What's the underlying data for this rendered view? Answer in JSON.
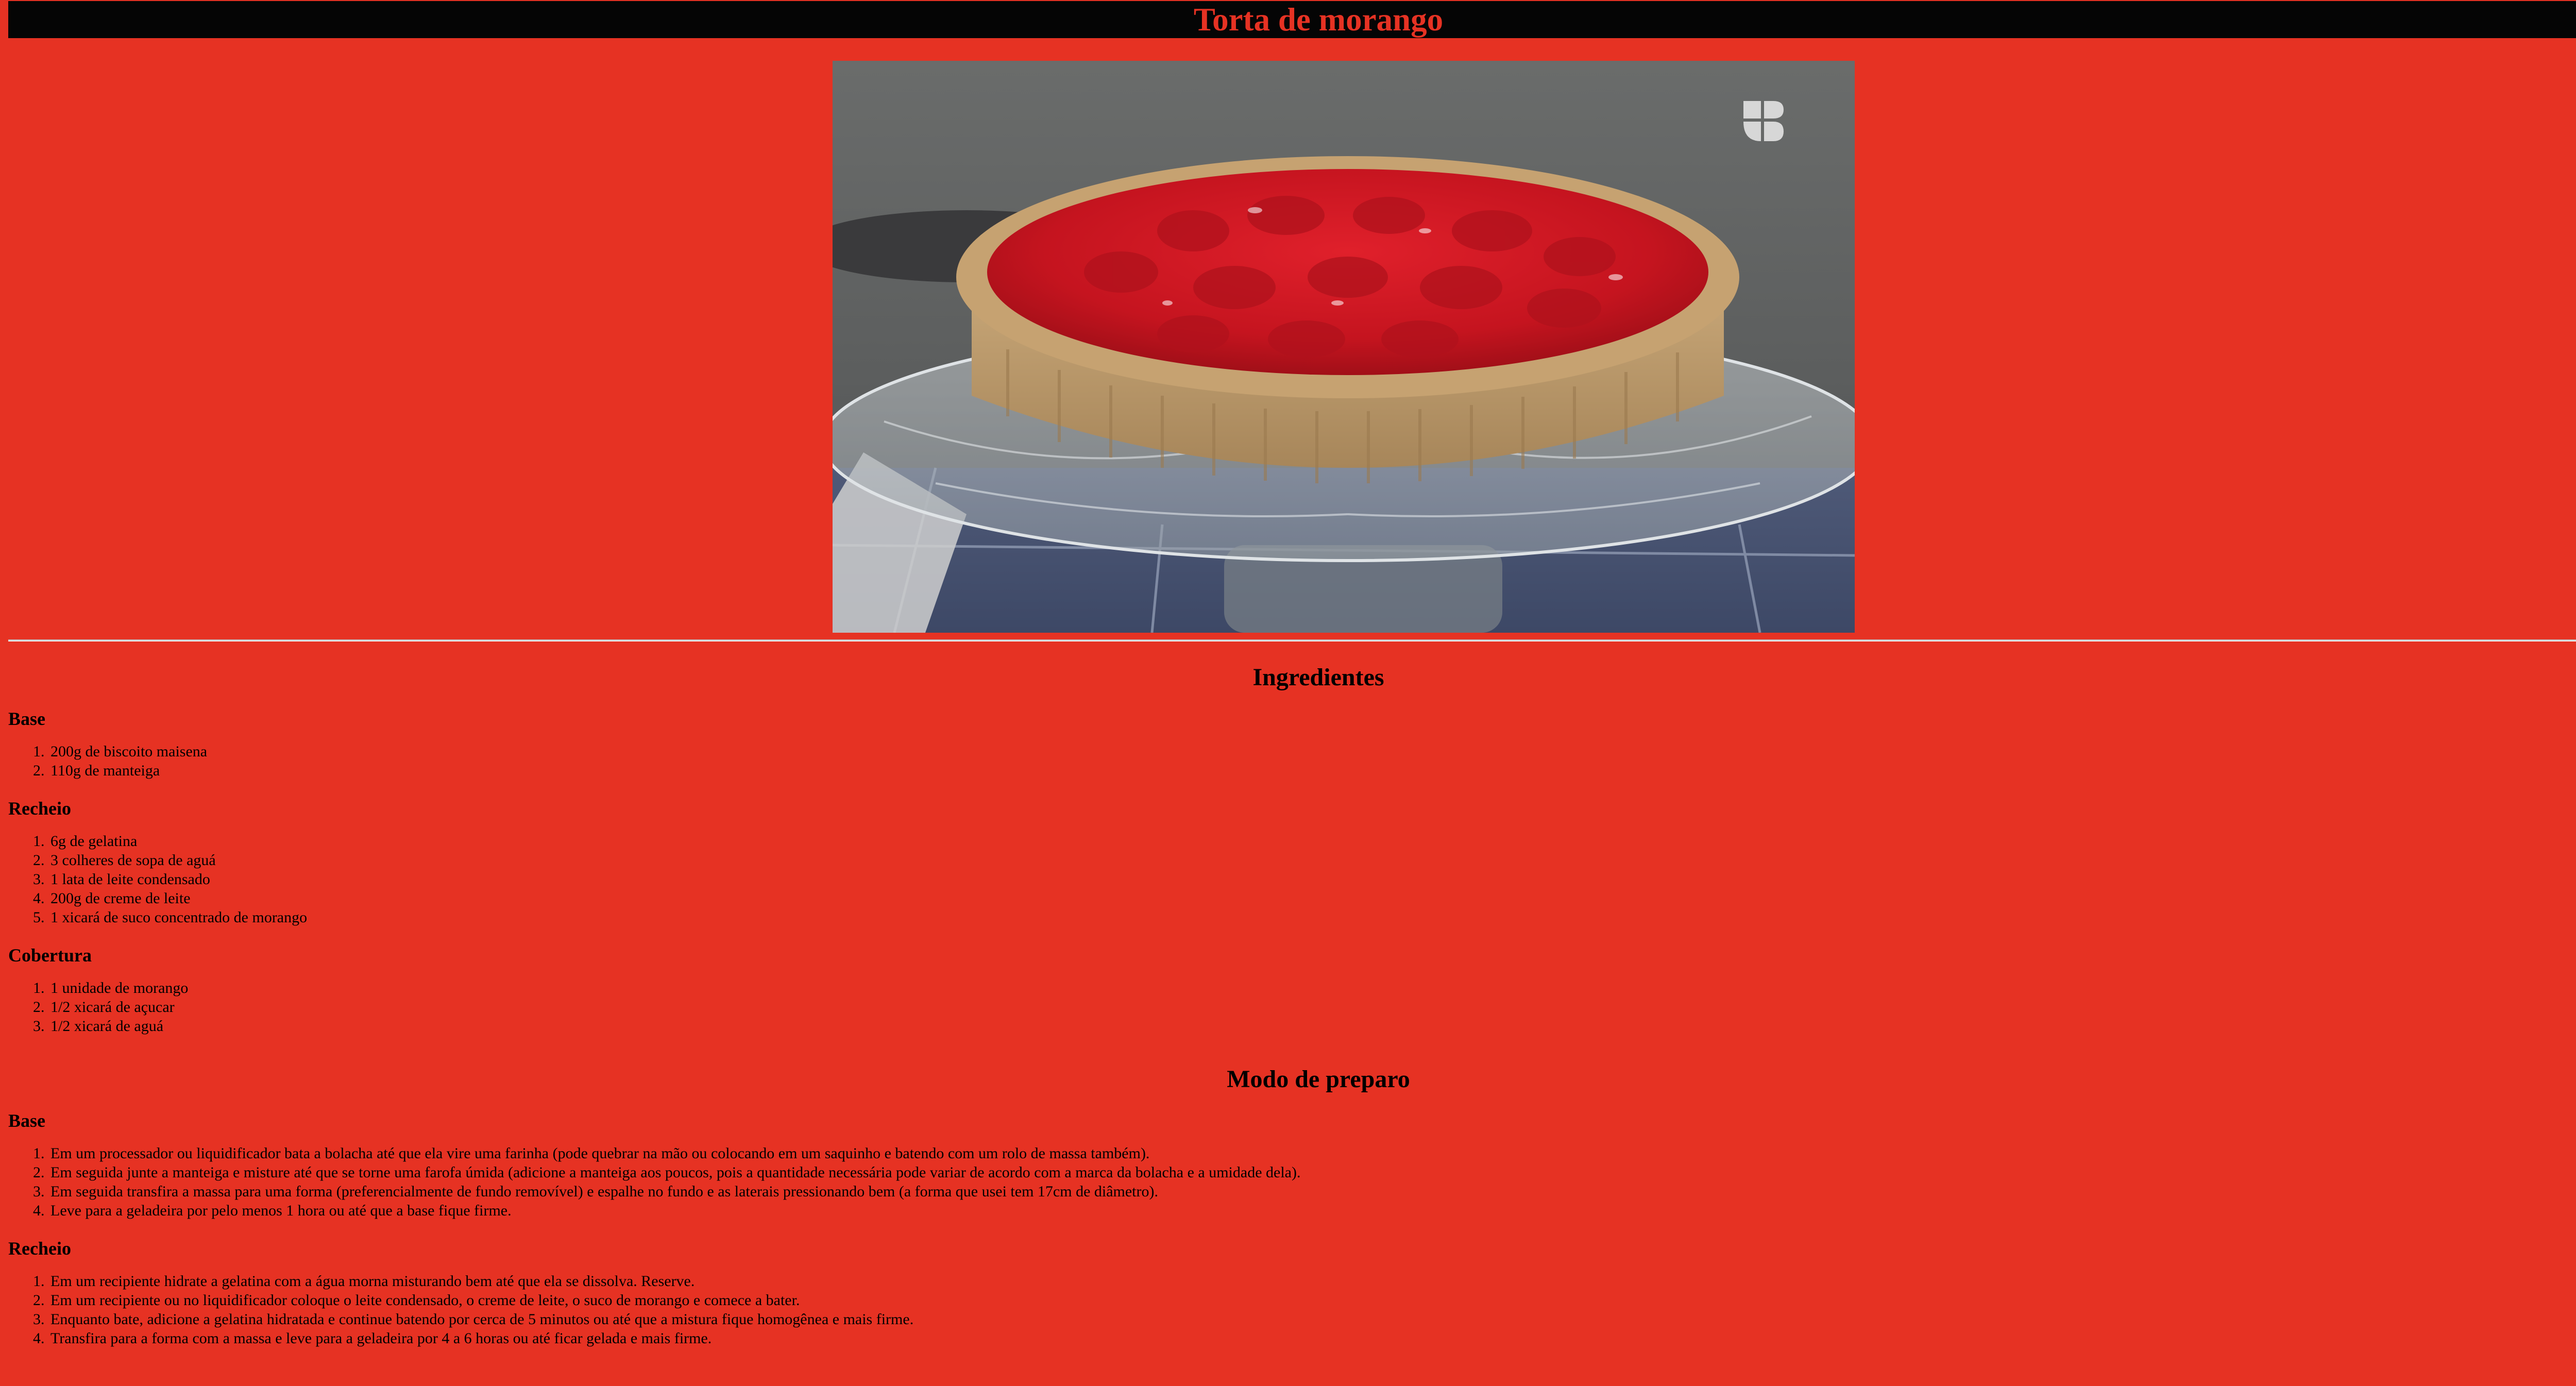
{
  "page": {
    "title": "Torta de morango",
    "colors": {
      "background": "#e63223",
      "title_bar": "#050505",
      "title_text": "#e63223"
    }
  },
  "hero_image": {
    "subject": "strawberry tart on glass cake stand",
    "logo_icon": "brand-logo-icon"
  },
  "ingredients": {
    "heading": "Ingredientes",
    "groups": [
      {
        "name": "Base",
        "items": [
          "200g de biscoito maisena",
          "110g de manteiga"
        ]
      },
      {
        "name": "Recheio",
        "items": [
          "6g de gelatina",
          "3 colheres de sopa de aguá",
          "1 lata de leite condensado",
          "200g de creme de leite",
          "1 xicará de suco concentrado de morango"
        ]
      },
      {
        "name": "Cobertura",
        "items": [
          "1 unidade de morango",
          "1/2 xicará de açucar",
          "1/2 xicará de aguá"
        ]
      }
    ]
  },
  "preparation": {
    "heading": "Modo de preparo",
    "groups": [
      {
        "name": "Base",
        "items": [
          "Em um processador ou liquidificador bata a bolacha até que ela vire uma farinha (pode quebrar na mão ou colocando em um saquinho e batendo com um rolo de massa também).",
          "Em seguida junte a manteiga e misture até que se torne uma farofa úmida (adicione a manteiga aos poucos, pois a quantidade necessária pode variar de acordo com a marca da bolacha e a umidade dela).",
          "Em seguida transfira a massa para uma forma (preferencialmente de fundo removível) e espalhe no fundo e as laterais pressionando bem (a forma que usei tem 17cm de diâmetro).",
          "Leve para a geladeira por pelo menos 1 hora ou até que a base fique firme."
        ]
      },
      {
        "name": "Recheio",
        "items": [
          "Em um recipiente hidrate a gelatina com a água morna misturando bem até que ela se dissolva. Reserve.",
          "Em um recipiente ou no liquidificador coloque o leite condensado, o creme de leite, o suco de morango e comece a bater.",
          "Enquanto bate, adicione a gelatina hidratada e continue batendo por cerca de 5 minutos ou até que a mistura fique homogênea e mais firme.",
          "Transfira para a forma com a massa e leve para a geladeira por 4 a 6 horas ou até ficar gelada e mais firme."
        ]
      }
    ]
  }
}
